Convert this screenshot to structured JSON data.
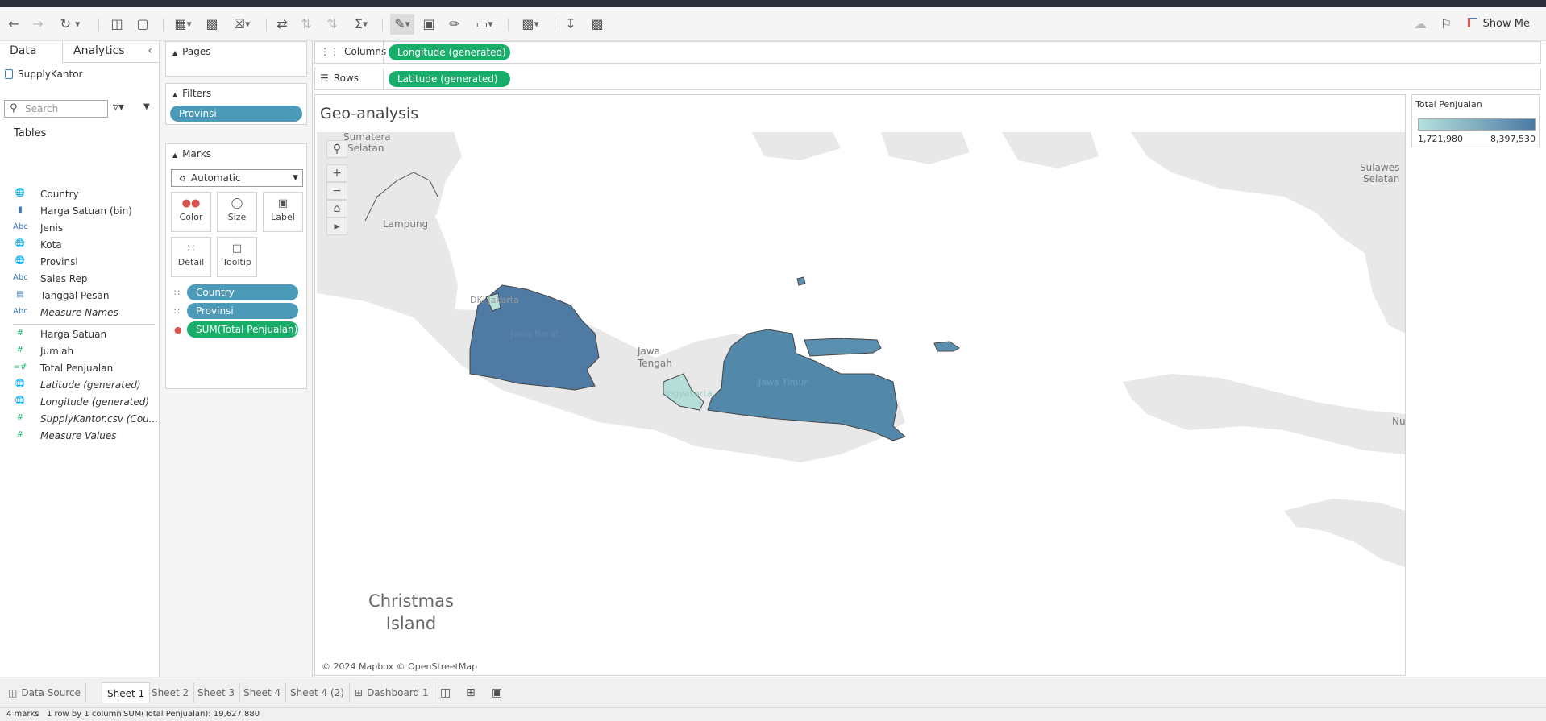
{
  "toolbar": {
    "show_me_label": "Show Me"
  },
  "data_pane": {
    "tab_data": "Data",
    "tab_analytics": "Analytics",
    "datasource": "SupplyKantor",
    "search_placeholder": "Search",
    "tables_heading": "Tables",
    "dimensions": [
      {
        "icon": "globe",
        "label": "Country"
      },
      {
        "icon": "bin",
        "label": "Harga Satuan (bin)"
      },
      {
        "icon": "Abc",
        "label": "Jenis"
      },
      {
        "icon": "globe",
        "label": "Kota"
      },
      {
        "icon": "globe",
        "label": "Provinsi"
      },
      {
        "icon": "Abc",
        "label": "Sales Rep"
      },
      {
        "icon": "calendar",
        "label": "Tanggal Pesan"
      },
      {
        "icon": "Abc",
        "label": "Measure Names"
      }
    ],
    "measures": [
      {
        "icon": "#",
        "label": "Harga Satuan"
      },
      {
        "icon": "#",
        "label": "Jumlah"
      },
      {
        "icon": "=#",
        "label": "Total Penjualan"
      },
      {
        "icon": "globe",
        "label": "Latitude (generated)"
      },
      {
        "icon": "globe",
        "label": "Longitude (generated)"
      },
      {
        "icon": "#",
        "label": "SupplyKantor.csv (Cou..."
      },
      {
        "icon": "#",
        "label": "Measure Values"
      }
    ]
  },
  "shelves": {
    "pages_label": "Pages",
    "filters_label": "Filters",
    "filter_pill": "Provinsi",
    "marks_label": "Marks",
    "mark_type": "Automatic",
    "mark_buttons": [
      "Color",
      "Size",
      "Label",
      "Detail",
      "Tooltip"
    ],
    "mark_pills": [
      "Country",
      "Provinsi",
      "SUM(Total Penjualan)"
    ],
    "columns_label": "Columns",
    "columns_pill": "Longitude (generated)",
    "rows_label": "Rows",
    "rows_pill": "Latitude (generated)"
  },
  "viz": {
    "title": "Geo-analysis",
    "map_labels": {
      "sumatera_selatan": [
        "Sumatera",
        "Selatan"
      ],
      "lampung": "Lampung",
      "dki": "DKI Jakarta",
      "jawa_barat": "Jawa Barat",
      "jawa_tengah": [
        "Jawa",
        "Tengah"
      ],
      "yogyakarta": "Yogyakarta",
      "jawa_timur": "Jawa Timur",
      "sulawesi_selatan": [
        "Sulawes",
        "Selatan"
      ],
      "nu": "Nu",
      "christmas_island": [
        "Christmas",
        "Island"
      ]
    },
    "copyright": "© 2024 Mapbox © OpenStreetMap",
    "colors": {
      "low": "#b6e0dd",
      "high": "#4c7aa3",
      "jawa_barat": "#4e7aa4",
      "jawa_timur": "#5289ab",
      "madura": "#5b8fb0",
      "yogyakarta": "#b5ded9",
      "dki": "#b8e1dc",
      "land": "#e8e8e8"
    }
  },
  "legend": {
    "title": "Total Penjualan",
    "min": "1,721,980",
    "max": "8,397,530"
  },
  "sheet_tabs": {
    "data_source": "Data Source",
    "sheets": [
      "Sheet 1",
      "Sheet 2",
      "Sheet 3",
      "Sheet 4",
      "Sheet 4 (2)"
    ],
    "dashboard": "Dashboard 1",
    "active": "Sheet 1"
  },
  "status": {
    "marks": "4 marks",
    "dims": "1 row by 1 column",
    "sum": "SUM(Total Penjualan): 19,627,880"
  }
}
